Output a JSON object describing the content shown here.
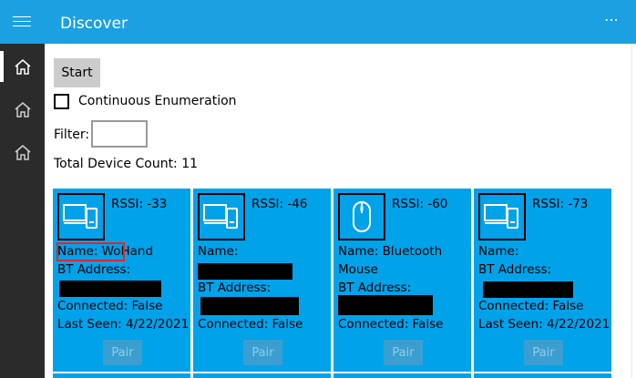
{
  "app": {
    "title": "Discover",
    "menu_icon": "hamburger-icon",
    "more_label": "⋯"
  },
  "sidebar": {
    "items": [
      {
        "icon": "home-icon",
        "active": true
      },
      {
        "icon": "home-icon",
        "active": false
      },
      {
        "icon": "home-icon",
        "active": false
      }
    ]
  },
  "controls": {
    "start_label": "Start",
    "continuous_label": "Continuous Enumeration",
    "continuous_checked": false,
    "filter_label": "Filter:",
    "filter_value": "",
    "count_text": "Total Device Count: 11"
  },
  "devices": [
    {
      "icon": "device-icon",
      "rssi": "RSSI: -33",
      "name_line": "Name: WoHand",
      "bt_label": "BT Address:",
      "connected": "Connected: False",
      "last_seen": "Last Seen: 4/22/2021",
      "pair_label": "Pair"
    },
    {
      "icon": "device-icon",
      "rssi": "RSSI: -46",
      "name_line": "Name:",
      "bt_label": "BT Address:",
      "connected": "Connected: False",
      "pair_label": "Pair"
    },
    {
      "icon": "mouse-icon",
      "rssi": "RSSI: -60",
      "name_line": "Name: Bluetooth",
      "name_line2": "Mouse",
      "bt_label": "BT Address:",
      "connected": "Connected: False",
      "pair_label": "Pair"
    },
    {
      "icon": "device-icon",
      "rssi": "RSSI: -73",
      "name_line": "Name:",
      "bt_label": "BT Address:",
      "connected": "Connected: False",
      "last_seen": "Last Seen: 4/22/2021",
      "pair_label": "Pair"
    }
  ],
  "colors": {
    "accent": "#1ba1e2",
    "card": "#00a2ea",
    "sidebar": "#2b2b2b",
    "highlight": "#e3262a"
  }
}
